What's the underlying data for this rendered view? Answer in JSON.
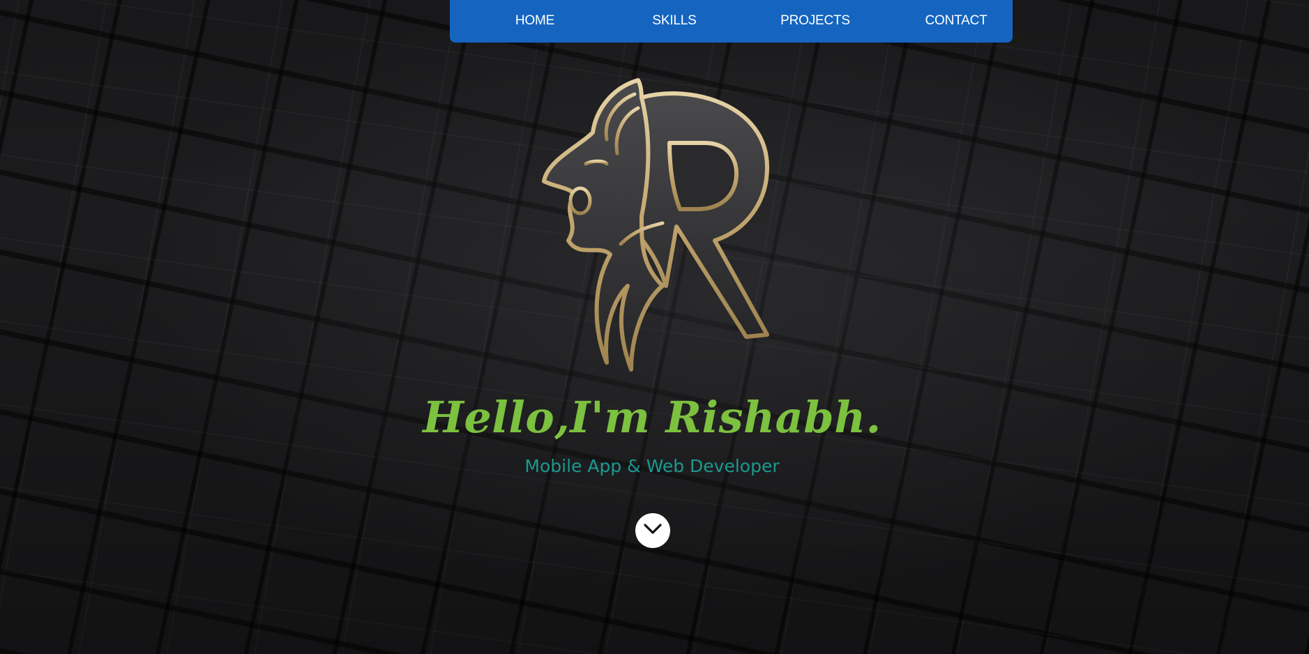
{
  "nav": {
    "items": [
      {
        "label": "HOME"
      },
      {
        "label": "SKILLS"
      },
      {
        "label": "PROJECTS"
      },
      {
        "label": "CONTACT"
      }
    ],
    "background": "#1565c0"
  },
  "hero": {
    "greeting": "Hello,I'm Rishabh.",
    "subtitle": "Mobile App & Web Developer",
    "greeting_color": "#7cc13f",
    "subtitle_color": "#1a9a8f",
    "logo_icon": "lion-r-logo-icon",
    "logo_color": "#c8b07a"
  },
  "scroll_button": {
    "icon": "chevron-down-icon"
  }
}
